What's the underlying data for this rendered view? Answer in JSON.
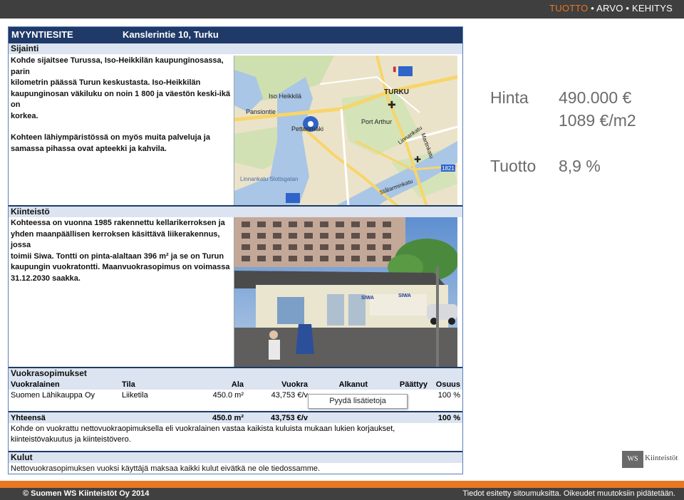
{
  "header": {
    "tagline": {
      "w1": "TUOTTO",
      "sep1": " • ",
      "w2": "ARVO",
      "sep2": " • ",
      "w3": "KEHITYS"
    }
  },
  "listing": {
    "label": "MYYNTIESITE",
    "address": "Kanslerintie 10, Turku",
    "sijainti": {
      "title": "Sijainti",
      "p1": [
        "Kohde sijaitsee Turussa, Iso-Heikkilän kaupunginosassa, parin",
        "kilometrin päässä Turun keskustasta. Iso-Heikkilän",
        "kaupunginosan väkiluku on noin 1 800 ja väestön keski-ikä on",
        "korkea."
      ],
      "p2": [
        "Kohteen lähiympäristössä on myös muita palveluja ja",
        "samassa pihassa ovat apteekki ja kahvila."
      ]
    },
    "kiinteisto": {
      "title": "Kiinteistö",
      "lines": [
        "Kohteessa on vuonna 1985 rakennettu kellarikerroksen ja",
        "yhden maanpäällisen kerroksen käsittävä liikerakennus, jossa",
        "toimii Siwa. Tontti on pinta-alaltaan 396 m² ja se on Turun",
        "kaupungin vuokratontti. Maanvuokrasopimus on voimassa",
        "31.12.2030 saakka."
      ]
    },
    "map_labels": {
      "turku": "TURKU",
      "iso_heikkila": "Iso Heikkilä",
      "pansiontie": "Pansiontie",
      "pettenmaki": "Pettenmäki",
      "port_arthur": "Port Arthur",
      "linnankatu": "Linnankatu",
      "martinkatu": "Martinkatu",
      "slottsgatan": "Linnankatu Slottsgatan",
      "stalarminkatu": "Stålarminkatu",
      "road_num": "1821"
    },
    "photo_signs": {
      "sign1": "SIWA",
      "sign2": "SIWA"
    },
    "vuokrasopimukset": {
      "title": "Vuokrasopimukset",
      "columns": [
        "Vuokralainen",
        "Tila",
        "Ala",
        "Vuokra",
        "Alkanut",
        "Päättyy",
        "Osuus"
      ],
      "rows": [
        {
          "tenant": "Suomen Lähikauppa Oy",
          "space": "Liiketila",
          "area": "450.0 m²",
          "rent": "43,753 €/v",
          "start": "",
          "end": "",
          "share": "100 %"
        }
      ],
      "total_label": "Yhteensä",
      "total_area": "450.0 m²",
      "total_rent": "43,753 €/v",
      "total_share": "100 %",
      "notes": [
        "Kohde on vuokrattu nettovuokraopimuksella eli vuokralainen vastaa kaikista kuluista mukaan lukien korjaukset,",
        "kiinteistövakuutus ja kiinteistövero."
      ]
    },
    "kulut": {
      "title": "Kulut",
      "text": "Nettovuokrasopimuksen vuoksi käyttäjä maksaa kaikki kulut eivätkä ne ole tiedossamme."
    },
    "request_button": "Pyydä lisätietoja"
  },
  "summary": {
    "price_label": "Hinta",
    "price": "490.000 €",
    "price_per_m2": "1089 €/m2",
    "yield_label": "Tuotto",
    "yield": "8,9 %"
  },
  "logo": {
    "mark": "WS",
    "name": "Kiinteistöt"
  },
  "footer": {
    "copyright": "© Suomen WS Kiinteistöt Oy 2014",
    "disclaimer": "Tiedot esitetty sitoumuksitta. Oikeudet muutoksiin pidätetään."
  },
  "colors": {
    "accent": "#e87722",
    "navy": "#1f3a68",
    "section_bg": "#dbe4f0",
    "bar": "#404040"
  }
}
